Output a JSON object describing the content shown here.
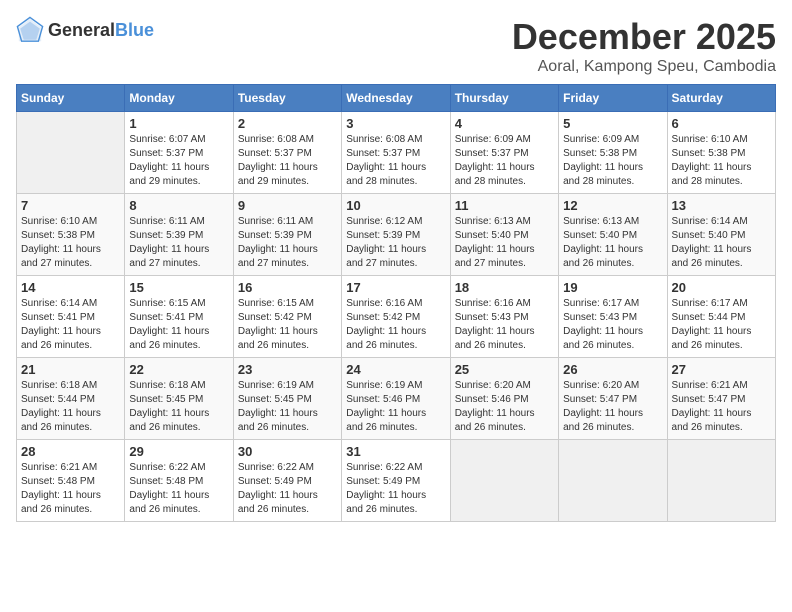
{
  "header": {
    "logo_general": "General",
    "logo_blue": "Blue",
    "month_title": "December 2025",
    "subtitle": "Aoral, Kampong Speu, Cambodia"
  },
  "weekdays": [
    "Sunday",
    "Monday",
    "Tuesday",
    "Wednesday",
    "Thursday",
    "Friday",
    "Saturday"
  ],
  "weeks": [
    [
      {
        "num": "",
        "info": ""
      },
      {
        "num": "1",
        "info": "Sunrise: 6:07 AM\nSunset: 5:37 PM\nDaylight: 11 hours\nand 29 minutes."
      },
      {
        "num": "2",
        "info": "Sunrise: 6:08 AM\nSunset: 5:37 PM\nDaylight: 11 hours\nand 29 minutes."
      },
      {
        "num": "3",
        "info": "Sunrise: 6:08 AM\nSunset: 5:37 PM\nDaylight: 11 hours\nand 28 minutes."
      },
      {
        "num": "4",
        "info": "Sunrise: 6:09 AM\nSunset: 5:37 PM\nDaylight: 11 hours\nand 28 minutes."
      },
      {
        "num": "5",
        "info": "Sunrise: 6:09 AM\nSunset: 5:38 PM\nDaylight: 11 hours\nand 28 minutes."
      },
      {
        "num": "6",
        "info": "Sunrise: 6:10 AM\nSunset: 5:38 PM\nDaylight: 11 hours\nand 28 minutes."
      }
    ],
    [
      {
        "num": "7",
        "info": "Sunrise: 6:10 AM\nSunset: 5:38 PM\nDaylight: 11 hours\nand 27 minutes."
      },
      {
        "num": "8",
        "info": "Sunrise: 6:11 AM\nSunset: 5:39 PM\nDaylight: 11 hours\nand 27 minutes."
      },
      {
        "num": "9",
        "info": "Sunrise: 6:11 AM\nSunset: 5:39 PM\nDaylight: 11 hours\nand 27 minutes."
      },
      {
        "num": "10",
        "info": "Sunrise: 6:12 AM\nSunset: 5:39 PM\nDaylight: 11 hours\nand 27 minutes."
      },
      {
        "num": "11",
        "info": "Sunrise: 6:13 AM\nSunset: 5:40 PM\nDaylight: 11 hours\nand 27 minutes."
      },
      {
        "num": "12",
        "info": "Sunrise: 6:13 AM\nSunset: 5:40 PM\nDaylight: 11 hours\nand 26 minutes."
      },
      {
        "num": "13",
        "info": "Sunrise: 6:14 AM\nSunset: 5:40 PM\nDaylight: 11 hours\nand 26 minutes."
      }
    ],
    [
      {
        "num": "14",
        "info": "Sunrise: 6:14 AM\nSunset: 5:41 PM\nDaylight: 11 hours\nand 26 minutes."
      },
      {
        "num": "15",
        "info": "Sunrise: 6:15 AM\nSunset: 5:41 PM\nDaylight: 11 hours\nand 26 minutes."
      },
      {
        "num": "16",
        "info": "Sunrise: 6:15 AM\nSunset: 5:42 PM\nDaylight: 11 hours\nand 26 minutes."
      },
      {
        "num": "17",
        "info": "Sunrise: 6:16 AM\nSunset: 5:42 PM\nDaylight: 11 hours\nand 26 minutes."
      },
      {
        "num": "18",
        "info": "Sunrise: 6:16 AM\nSunset: 5:43 PM\nDaylight: 11 hours\nand 26 minutes."
      },
      {
        "num": "19",
        "info": "Sunrise: 6:17 AM\nSunset: 5:43 PM\nDaylight: 11 hours\nand 26 minutes."
      },
      {
        "num": "20",
        "info": "Sunrise: 6:17 AM\nSunset: 5:44 PM\nDaylight: 11 hours\nand 26 minutes."
      }
    ],
    [
      {
        "num": "21",
        "info": "Sunrise: 6:18 AM\nSunset: 5:44 PM\nDaylight: 11 hours\nand 26 minutes."
      },
      {
        "num": "22",
        "info": "Sunrise: 6:18 AM\nSunset: 5:45 PM\nDaylight: 11 hours\nand 26 minutes."
      },
      {
        "num": "23",
        "info": "Sunrise: 6:19 AM\nSunset: 5:45 PM\nDaylight: 11 hours\nand 26 minutes."
      },
      {
        "num": "24",
        "info": "Sunrise: 6:19 AM\nSunset: 5:46 PM\nDaylight: 11 hours\nand 26 minutes."
      },
      {
        "num": "25",
        "info": "Sunrise: 6:20 AM\nSunset: 5:46 PM\nDaylight: 11 hours\nand 26 minutes."
      },
      {
        "num": "26",
        "info": "Sunrise: 6:20 AM\nSunset: 5:47 PM\nDaylight: 11 hours\nand 26 minutes."
      },
      {
        "num": "27",
        "info": "Sunrise: 6:21 AM\nSunset: 5:47 PM\nDaylight: 11 hours\nand 26 minutes."
      }
    ],
    [
      {
        "num": "28",
        "info": "Sunrise: 6:21 AM\nSunset: 5:48 PM\nDaylight: 11 hours\nand 26 minutes."
      },
      {
        "num": "29",
        "info": "Sunrise: 6:22 AM\nSunset: 5:48 PM\nDaylight: 11 hours\nand 26 minutes."
      },
      {
        "num": "30",
        "info": "Sunrise: 6:22 AM\nSunset: 5:49 PM\nDaylight: 11 hours\nand 26 minutes."
      },
      {
        "num": "31",
        "info": "Sunrise: 6:22 AM\nSunset: 5:49 PM\nDaylight: 11 hours\nand 26 minutes."
      },
      {
        "num": "",
        "info": ""
      },
      {
        "num": "",
        "info": ""
      },
      {
        "num": "",
        "info": ""
      }
    ]
  ]
}
